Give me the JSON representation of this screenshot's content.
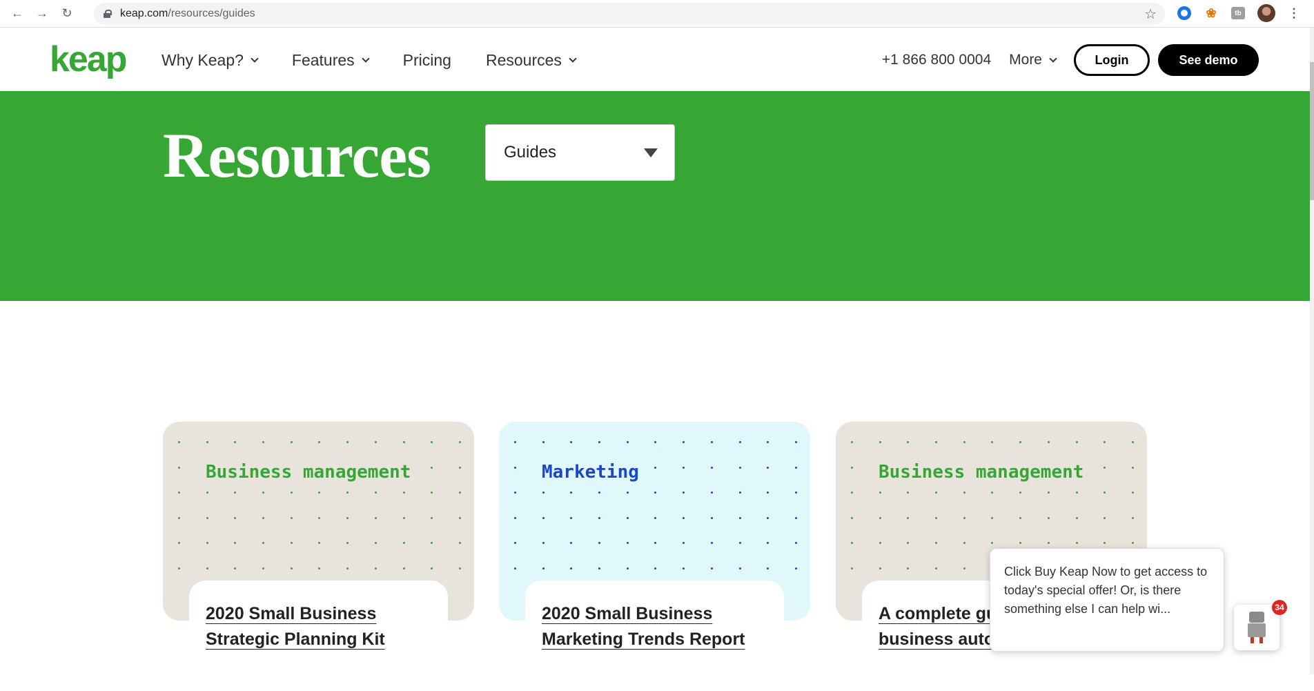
{
  "browser": {
    "url_host": "keap.com",
    "url_path": "/resources/guides"
  },
  "header": {
    "logo": "keap",
    "nav": [
      {
        "label": "Why Keap?",
        "dropdown": true
      },
      {
        "label": "Features",
        "dropdown": true
      },
      {
        "label": "Pricing",
        "dropdown": false
      },
      {
        "label": "Resources",
        "dropdown": true
      }
    ],
    "phone": "+1 866 800 0004",
    "more": "More",
    "login": "Login",
    "demo": "See demo"
  },
  "hero": {
    "title": "Resources",
    "select_value": "Guides"
  },
  "cards": [
    {
      "tag": "Business management",
      "title": "2020 Small Business Strategic Planning Kit",
      "bg": "#e8e4dc",
      "accent": "#36a635"
    },
    {
      "tag": "Marketing",
      "title": "2020 Small Business Marketing Trends Report",
      "bg": "#e0f7fc",
      "accent": "#1a47c9"
    },
    {
      "tag": "Business management",
      "title": "A complete guide to business automation",
      "bg": "#e8e4dc",
      "accent": "#36a635"
    }
  ],
  "chat": {
    "message": "Click Buy Keap Now to get access to today's special offer! Or, is there something else I can help wi...",
    "badge": "34"
  },
  "colors": {
    "brand_green": "#36a635",
    "marketing_blue": "#1a47c9"
  }
}
